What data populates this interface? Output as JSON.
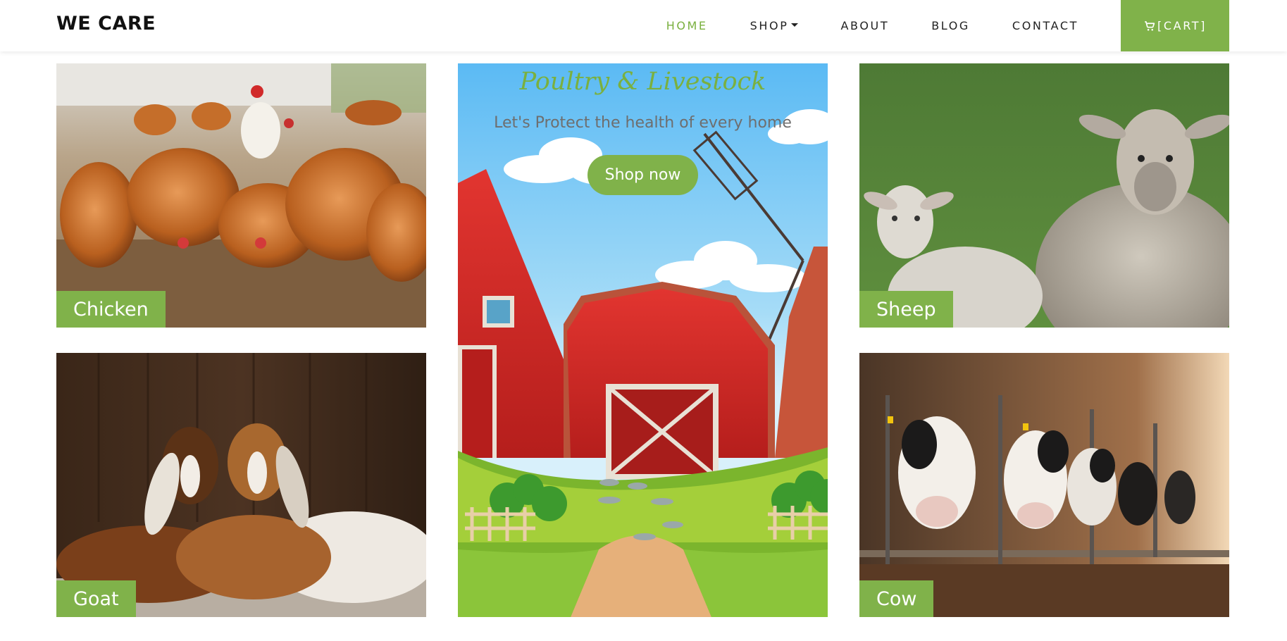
{
  "header": {
    "logo": "WE CARE",
    "nav": [
      {
        "label": "HOME"
      },
      {
        "label": "SHOP"
      },
      {
        "label": "ABOUT"
      },
      {
        "label": "BLOG"
      },
      {
        "label": "CONTACT"
      }
    ],
    "cart_label": "[CART]",
    "active_item": "HOME"
  },
  "hero": {
    "title": "Poultry & Livestock",
    "subtitle": "Let's Protect the health of every home",
    "button_label": "Shop now"
  },
  "tiles": {
    "chicken": "Chicken",
    "sheep": "Sheep",
    "goat": "Goat",
    "cow": "Cow"
  },
  "colors": {
    "accent": "#80b24a",
    "accent_text": "#7ab03f"
  },
  "icons": {
    "cart": "cart-icon",
    "shop_dropdown": "caret-down-icon"
  }
}
